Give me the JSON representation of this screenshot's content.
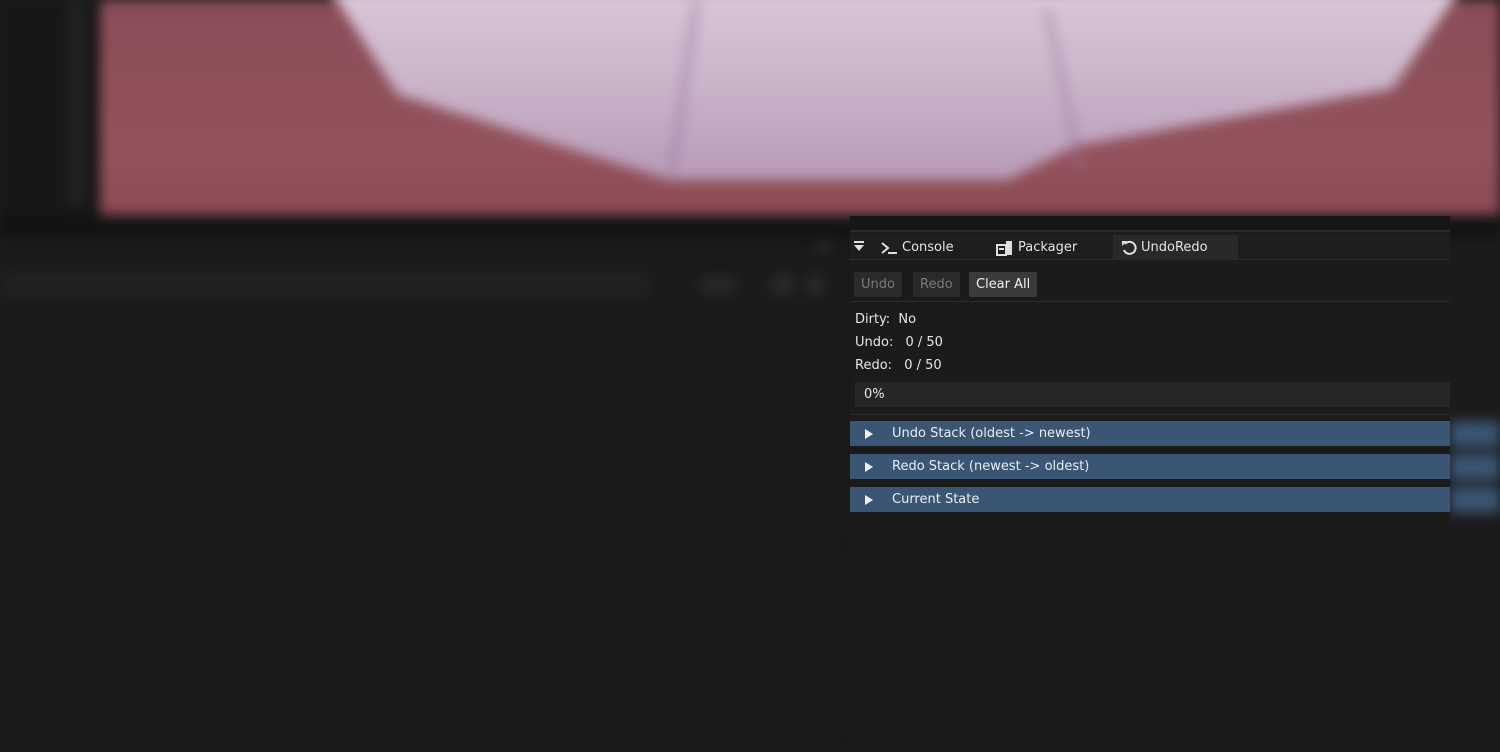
{
  "dock": {
    "tabs": [
      {
        "label": "Console",
        "icon": "terminal-icon"
      },
      {
        "label": "Packager",
        "icon": "packager-icon"
      },
      {
        "label": "UndoRedo",
        "icon": "undo-icon"
      }
    ],
    "active_tab": "UndoRedo"
  },
  "toolbar": {
    "undo_label": "Undo",
    "redo_label": "Redo",
    "clear_label": "Clear All"
  },
  "status": {
    "dirty_label": "Dirty:",
    "dirty_value": "No",
    "undo_label": "Undo:",
    "undo_value": "0 / 50",
    "redo_label": "Redo:",
    "redo_value": "0 / 50"
  },
  "progress": {
    "text": "0%",
    "value": 0
  },
  "tree": {
    "undo_stack": "Undo Stack (oldest -> newest)",
    "redo_stack": "Redo Stack (newest -> oldest)",
    "current_state": "Current State"
  },
  "colors": {
    "accent_row": "#3b5574",
    "panel_bg": "#1b1b1b",
    "viewport_red": "#8f4f59",
    "viewport_shape": "#cdb8cc"
  }
}
